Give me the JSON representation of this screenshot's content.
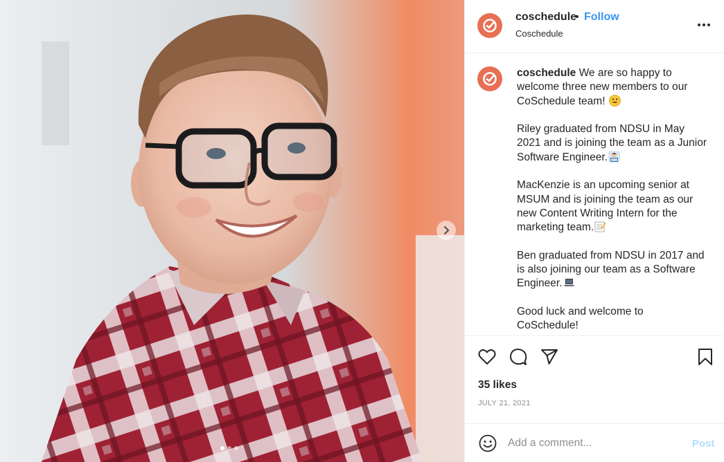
{
  "post": {
    "username": "coschedule",
    "separator": "•",
    "follow_label": "Follow",
    "location": "Coschedule",
    "more_icon": "more-horizontal-icon",
    "caption": {
      "username": "coschedule",
      "p1": " We are so happy to welcome three new members to our CoSchedule team! ",
      "p2": "Riley graduated from NDSU in May 2021 and is joining the team as a Junior Software Engineer.",
      "p3": "MacKenzie is an upcoming senior at MSUM and is joining the team as our new Content Writing Intern for the marketing team.",
      "p4": "Ben graduated from NDSU in 2017 and is also joining our team as a Software Engineer.",
      "p5": "Good luck and welcome to CoSchedule!"
    },
    "likes": "35 likes",
    "date": "JULY 21, 2021",
    "comment_placeholder": "Add a comment...",
    "post_label": "Post",
    "carousel": {
      "total": 3,
      "active": 1
    }
  },
  "icons": {
    "like": "heart-icon",
    "comment": "comment-icon",
    "share": "send-icon",
    "save": "bookmark-icon",
    "emoji": "smiley-icon",
    "next": "chevron-right-icon"
  },
  "colors": {
    "brand": "#e86f53",
    "link": "#3897f0",
    "post_disabled": "#b2dffc",
    "muted": "#8e8e8e"
  }
}
